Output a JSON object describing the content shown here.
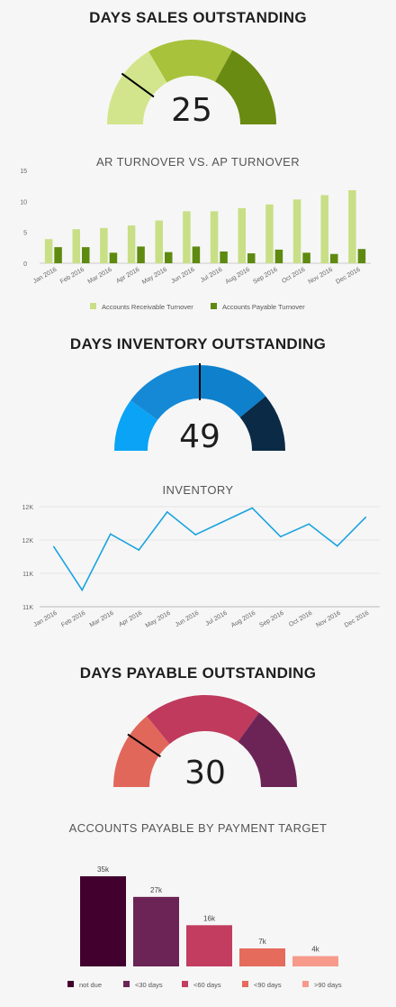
{
  "dso": {
    "title": "DAYS SALES OUTSTANDING",
    "value": "25",
    "value_fraction": 0.2,
    "colors": [
      "#d3e58c",
      "#a8c23c",
      "#698b11"
    ]
  },
  "ar_ap": {
    "title": "AR TURNOVER VS. AP TURNOVER"
  },
  "dio": {
    "title": "DAYS INVENTORY OUTSTANDING",
    "value": "49",
    "value_fraction": 0.5,
    "colors": [
      "#0aa3f5",
      "#1589d6",
      "#0f80cc",
      "#0a2a45"
    ]
  },
  "inventory": {
    "title": "INVENTORY"
  },
  "dpo": {
    "title": "DAYS PAYABLE OUTSTANDING",
    "value": "30",
    "value_fraction": 0.19,
    "colors": [
      "#e2675b",
      "#bf3a5c",
      "#6c2457"
    ]
  },
  "ap_target": {
    "title": "ACCOUNTS PAYABLE BY PAYMENT TARGET"
  },
  "chart_data": [
    {
      "type": "bar",
      "title": "AR TURNOVER VS. AP TURNOVER",
      "categories": [
        "Jan 2016",
        "Feb 2016",
        "Mar 2016",
        "Apr 2016",
        "May 2016",
        "Jun 2016",
        "Jul 2016",
        "Aug 2016",
        "Sep 2016",
        "Oct 2016",
        "Nov 2016",
        "Dec 2016"
      ],
      "series": [
        {
          "name": "Accounts Receivable Turnover",
          "color": "#c8df86",
          "values": [
            3.9,
            5.5,
            5.7,
            6.1,
            6.9,
            8.4,
            8.4,
            8.9,
            9.5,
            10.3,
            11.0,
            11.8
          ]
        },
        {
          "name": "Accounts Payable Turnover",
          "color": "#5e8a10",
          "values": [
            2.6,
            2.6,
            1.7,
            2.7,
            1.8,
            2.7,
            1.9,
            1.6,
            2.2,
            1.7,
            1.5,
            2.3
          ]
        }
      ],
      "yticks": [
        "0",
        "5",
        "10",
        "15"
      ],
      "ylim": [
        0,
        15
      ],
      "legend": "bottom",
      "grid": false
    },
    {
      "type": "line",
      "title": "INVENTORY",
      "categories": [
        "Jan 2016",
        "Feb 2016",
        "Mar 2016",
        "Apr 2016",
        "May 2016",
        "Jun 2016",
        "Jul 2016",
        "Aug 2016",
        "Sep 2016",
        "Oct 2016",
        "Nov 2016",
        "Dec 2016"
      ],
      "series": [
        {
          "color": "#1aa3e0",
          "values": [
            11.4,
            10.75,
            11.59,
            11.35,
            11.92,
            11.58,
            11.78,
            11.98,
            11.55,
            11.74,
            11.41,
            11.84
          ]
        }
      ],
      "yticks": [
        "11K",
        "11K",
        "12K",
        "12K"
      ],
      "ylim": [
        10.5,
        12.0
      ],
      "legend": "none",
      "grid": true
    },
    {
      "type": "bar",
      "title": "ACCOUNTS PAYABLE BY PAYMENT TARGET",
      "categories": [
        "not due",
        "<30 days",
        "<60 days",
        "<90 days",
        ">90 days"
      ],
      "values": [
        35,
        27,
        16,
        7,
        4
      ],
      "data_labels": [
        "35k",
        "27k",
        "16k",
        "7k",
        "4k"
      ],
      "colors": [
        "#41002e",
        "#6b2455",
        "#c23d5f",
        "#e56b5d",
        "#f79a8b"
      ],
      "legend": "bottom"
    }
  ]
}
